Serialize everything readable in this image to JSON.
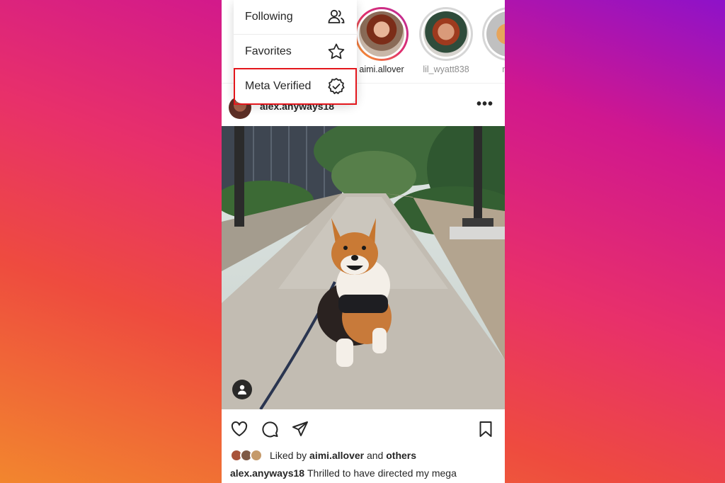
{
  "menu": {
    "items": [
      {
        "label": "Following",
        "icon": "following-icon"
      },
      {
        "label": "Favorites",
        "icon": "star-icon"
      },
      {
        "label": "Meta Verified",
        "icon": "verified-badge-icon"
      }
    ],
    "highlight_color": "#e3161c"
  },
  "stories": [
    {
      "username": "aimi.allover",
      "ring": "active"
    },
    {
      "username": "lil_wyatt838",
      "ring": "seen"
    },
    {
      "username": "mis",
      "ring": "seen"
    }
  ],
  "post": {
    "username": "alex.anyways18",
    "more_icon": "more-horizontal-icon",
    "liked_prefix": "Liked by",
    "liked_user": "aimi.allover",
    "liked_and": "and",
    "liked_others": "others",
    "caption_user": "alex.anyways18",
    "caption_text": "Thrilled to have directed my mega"
  },
  "actions": [
    "heart-icon",
    "comment-icon",
    "share-icon",
    "bookmark-icon"
  ],
  "colors": {
    "story_ring_gradient": [
      "#f9a825",
      "#e1306c",
      "#b92b9c"
    ],
    "background_gradient": [
      "#8e12c9",
      "#d0178f",
      "#e8306a",
      "#ee4b3f",
      "#f2862e"
    ]
  }
}
